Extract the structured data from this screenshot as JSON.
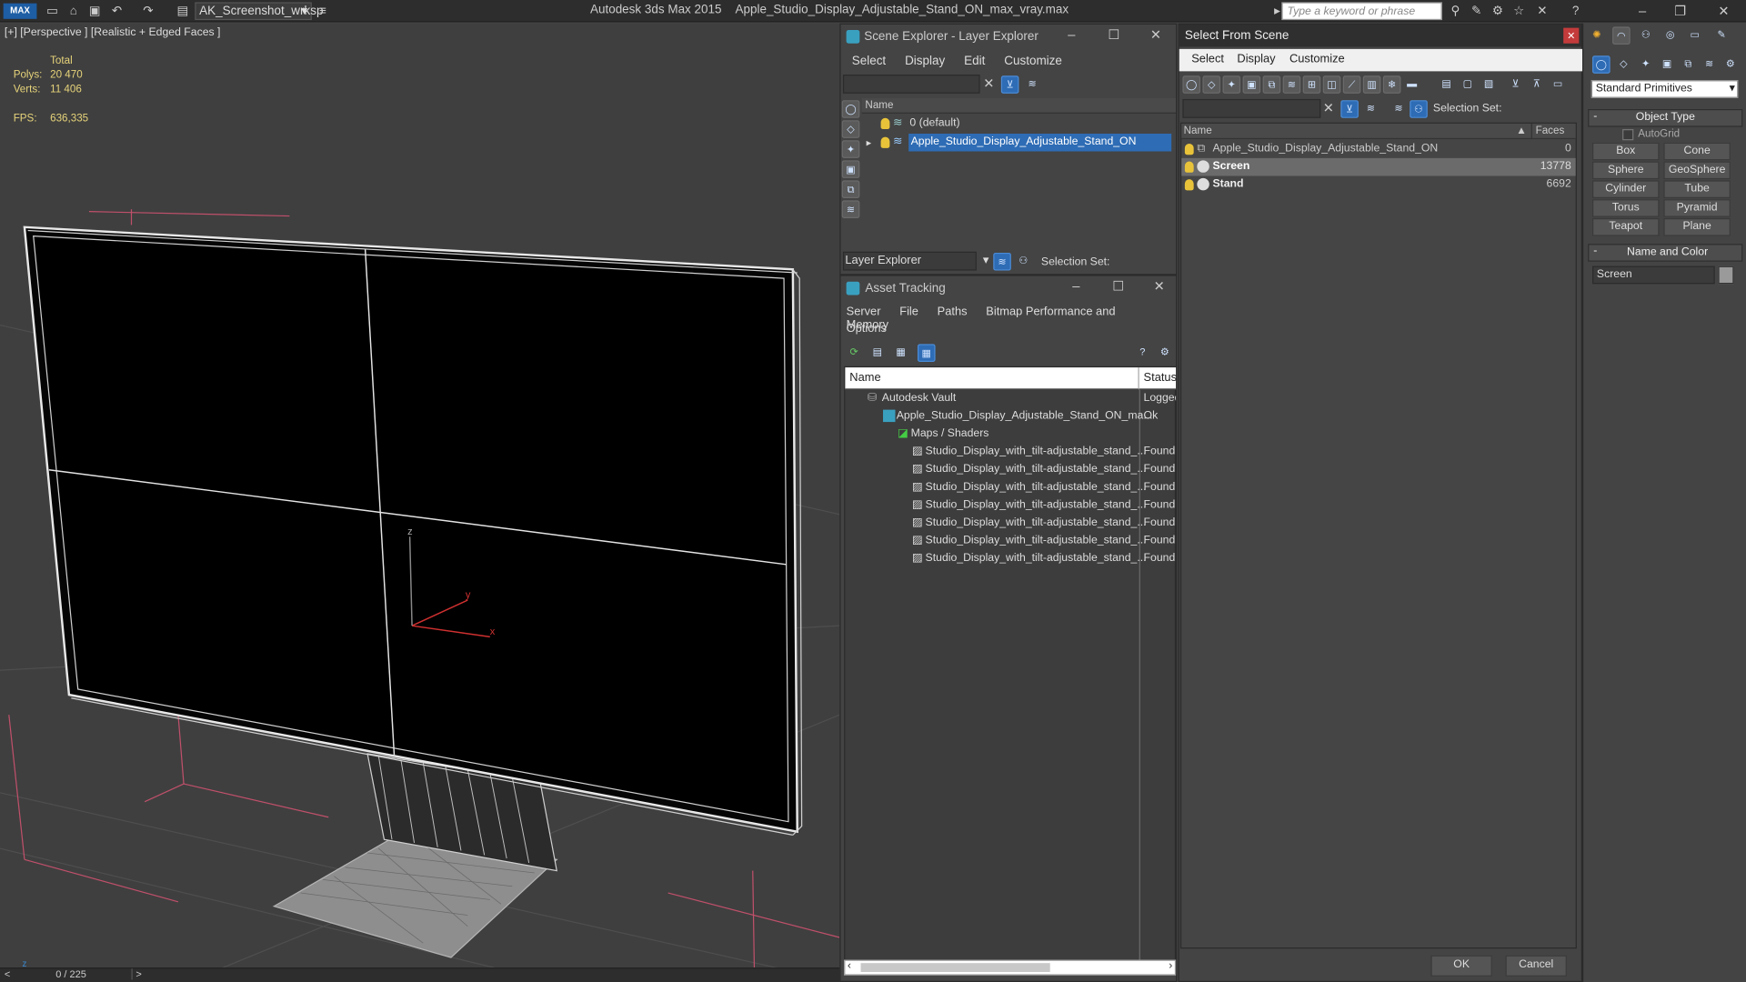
{
  "titlebar": {
    "logo": "MAX",
    "workspace": "AK_Screenshot_wrksp",
    "app": "Autodesk 3ds Max  2015",
    "file": "Apple_Studio_Display_Adjustable_Stand_ON_max_vray.max",
    "search_placeholder": "Type a keyword or phrase"
  },
  "viewport": {
    "label": "[+] [Perspective ] [Realistic + Edged Faces ]",
    "stats": {
      "total_label": "Total",
      "polys_label": "Polys:",
      "polys": "20 470",
      "verts_label": "Verts:",
      "verts": "11 406",
      "fps_label": "FPS:",
      "fps": "636,335"
    },
    "axis": {
      "x": "x",
      "y": "y",
      "z": "z"
    }
  },
  "timeline": {
    "frame": "0 / 225",
    "prev": "<",
    "next": ">"
  },
  "scene_explorer": {
    "title": "Scene Explorer - Layer Explorer",
    "menu": [
      "Select",
      "Display",
      "Edit",
      "Customize"
    ],
    "col_name": "Name",
    "rows": [
      "0 (default)",
      "Apple_Studio_Display_Adjustable_Stand_ON"
    ],
    "footer_label": "Layer Explorer",
    "selection_set": "Selection Set:"
  },
  "asset_tracking": {
    "title": "Asset Tracking",
    "menu": [
      "Server",
      "File",
      "Paths",
      "Bitmap Performance and Memory"
    ],
    "menu2": "Options",
    "col_name": "Name",
    "col_status": "Status",
    "rows": [
      {
        "name": "Autodesk Vault",
        "status": "Logged"
      },
      {
        "name": "Apple_Studio_Display_Adjustable_Stand_ON_ma...",
        "status": "Ok"
      },
      {
        "name": "Maps / Shaders",
        "status": ""
      },
      {
        "name": "Studio_Display_with_tilt-adjustable_stand_...",
        "status": "Found"
      },
      {
        "name": "Studio_Display_with_tilt-adjustable_stand_...",
        "status": "Found"
      },
      {
        "name": "Studio_Display_with_tilt-adjustable_stand_...",
        "status": "Found"
      },
      {
        "name": "Studio_Display_with_tilt-adjustable_stand_...",
        "status": "Found"
      },
      {
        "name": "Studio_Display_with_tilt-adjustable_stand_...",
        "status": "Found"
      },
      {
        "name": "Studio_Display_with_tilt-adjustable_stand_...",
        "status": "Found"
      },
      {
        "name": "Studio_Display_with_tilt-adjustable_stand_...",
        "status": "Found"
      }
    ]
  },
  "select_from_scene": {
    "title": "Select From Scene",
    "menu": [
      "Select",
      "Display",
      "Customize"
    ],
    "selection_set": "Selection Set:",
    "col_name": "Name",
    "col_faces": "Faces",
    "rows": [
      {
        "name": "Apple_Studio_Display_Adjustable_Stand_ON",
        "faces": "0"
      },
      {
        "name": "Screen",
        "faces": "13778"
      },
      {
        "name": "Stand",
        "faces": "6692"
      }
    ],
    "ok": "OK",
    "cancel": "Cancel"
  },
  "command_panel": {
    "dropdown": "Standard Primitives",
    "object_type": "Object Type",
    "autogrid": "AutoGrid",
    "buttons": [
      "Box",
      "Cone",
      "Sphere",
      "GeoSphere",
      "Cylinder",
      "Tube",
      "Torus",
      "Pyramid",
      "Teapot",
      "Plane"
    ],
    "name_and_color": "Name and Color",
    "name_value": "Screen",
    "rollout_minus": "-"
  },
  "colors": {
    "selection": "#2e6cb5",
    "stat_text": "#e6d37a",
    "grid_red": "#c0506b"
  }
}
